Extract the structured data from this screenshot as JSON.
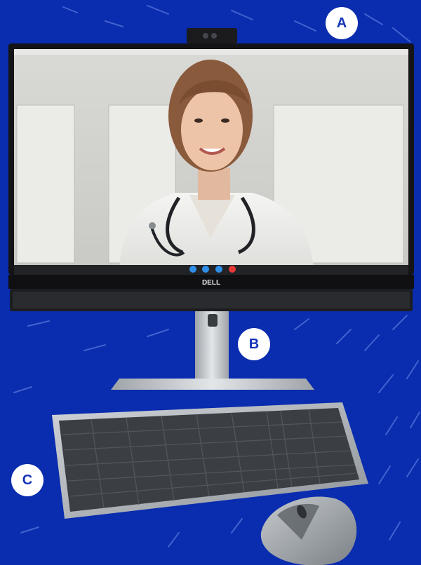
{
  "badges": {
    "a": "A",
    "b": "B",
    "c": "C"
  },
  "monitor": {
    "brand": "DELL"
  },
  "call_controls": [
    {
      "icon": "camera-icon",
      "color": "#2f8fe8"
    },
    {
      "icon": "mic-icon",
      "color": "#2f8fe8"
    },
    {
      "icon": "chat-icon",
      "color": "#2f8fe8"
    },
    {
      "icon": "end-call-icon",
      "color": "#e53935"
    }
  ],
  "colors": {
    "background": "#0a2cae",
    "badge_text": "#1434b8"
  }
}
